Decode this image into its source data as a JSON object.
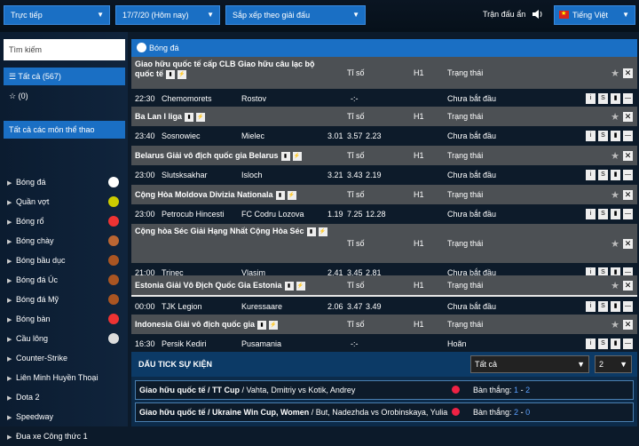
{
  "topbar": {
    "mode": "Trực tiếp",
    "date": "17/7/20 (Hôm nay)",
    "sort": "Sắp xếp theo giải đấu",
    "hide_label": "Trận đấu ẩn",
    "language": "Tiếng Việt"
  },
  "sidebar": {
    "search_placeholder": "Tìm kiếm",
    "all_label": "Tất cả (567)",
    "fav_label": "(0)",
    "sports_title": "Tất cả các môn thể thao",
    "sports": [
      "Bóng đá",
      "Quần vợt",
      "Bóng rổ",
      "Bóng chày",
      "Bóng bầu dục",
      "Bóng đá Úc",
      "Bóng đá Mỹ",
      "Bóng bàn",
      "Cầu lông",
      "Counter-Strike",
      "Liên Minh Huyền Thoại",
      "Dota 2",
      "Speedway",
      "Đua xe Công thức 1"
    ]
  },
  "main": {
    "title": "Bóng đá",
    "col_score": "Tỉ số",
    "col_h1": "H1",
    "col_status": "Trạng thái",
    "leagues": [
      {
        "name": "Giao hữu quốc tế cấp CLB Giao hữu câu lạc bộ quốc tế",
        "time": "22:30",
        "home": "Chemomorets",
        "away": "Rostov",
        "o1": "",
        "o2": "-:-",
        "o3": "",
        "status": "Chưa bắt đầu"
      },
      {
        "name": "Ba Lan I liga",
        "time": "23:40",
        "home": "Sosnowiec",
        "away": "Mielec",
        "o1": "3.01",
        "o2": "3.57",
        "o3": "2.23",
        "status": "Chưa bắt đầu"
      },
      {
        "name": "Belarus Giải vô địch quốc gia Belarus",
        "time": "23:00",
        "home": "Slutsksakhar",
        "away": "Isloch",
        "o1": "3.21",
        "o2": "3.43",
        "o3": "2.19",
        "status": "Chưa bắt đầu"
      },
      {
        "name": "Cộng Hòa Moldova Divizia Nationala",
        "time": "23:00",
        "home": "Petrocub Hincesti",
        "away": "FC Codru Lozova",
        "o1": "1.19",
        "o2": "7.25",
        "o3": "12.28",
        "status": "Chưa bắt đầu"
      },
      {
        "name": "Cộng hòa Séc Giải Hạng Nhất Cộng Hòa Séc",
        "time": "21:00",
        "home": "Trinec",
        "away": "Vlasim",
        "o1": "2.41",
        "o2": "3.45",
        "o3": "2.81",
        "status": "Chưa bắt đầu"
      },
      {
        "name": "Estonia Giải Vô Địch Quốc Gia Estonia",
        "time": "00:00",
        "home": "TJK Legion",
        "away": "Kuressaare",
        "o1": "2.06",
        "o2": "3.47",
        "o3": "3.49",
        "status": "Chưa bắt đầu"
      },
      {
        "name": "Indonesia Giải vô địch quốc gia",
        "time": "16:30",
        "home": "Persik Kediri",
        "away": "Pusamania",
        "o1": "",
        "o2": "-:-",
        "o3": "",
        "status": "Hoãn"
      }
    ]
  },
  "ticker": {
    "title": "DẤU TICK SỰ KIỆN",
    "filter": "Tất cả",
    "count": "2",
    "events": [
      {
        "league": "Giao hữu quốc tế / TT Cup",
        "players": " / Vahta, Dmitriy vs Kotik, Andrey",
        "label": "Bàn thắng: ",
        "s1": "1",
        "sep": " - ",
        "s2": "2"
      },
      {
        "league": "Giao hữu quốc tế / Ukraine Win Cup, Women",
        "players": " / But, Nadezhda vs Orobinskaya, Yulia",
        "label": "Bàn thắng: ",
        "s1": "2",
        "sep": " - ",
        "s2": "0"
      }
    ]
  }
}
